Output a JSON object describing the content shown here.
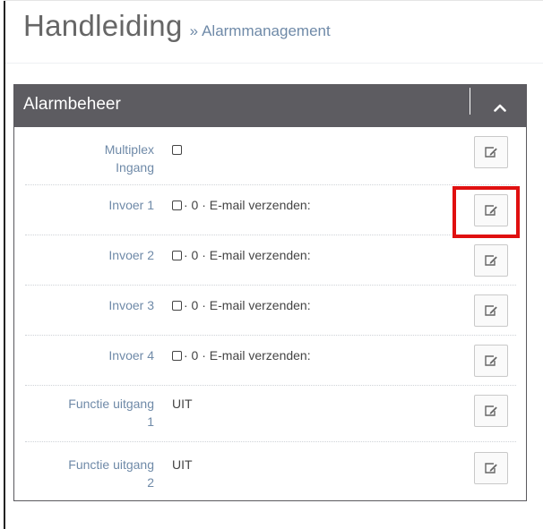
{
  "header": {
    "title": "Handleiding",
    "crumb_separator": "»",
    "crumb": "Alarmmanagement"
  },
  "panel": {
    "title": "Alarmbeheer",
    "collapse_icon": "chevron-up-icon",
    "rows": [
      {
        "label_line1": "Multiplex",
        "label_line2": "Ingang",
        "checkbox": true,
        "value": ""
      },
      {
        "label_line1": "Invoer 1",
        "label_line2": "",
        "checkbox": true,
        "value": "· 0 · E-mail verzenden:"
      },
      {
        "label_line1": "Invoer 2",
        "label_line2": "",
        "checkbox": true,
        "value": "· 0 · E-mail verzenden:"
      },
      {
        "label_line1": "Invoer 3",
        "label_line2": "",
        "checkbox": true,
        "value": "· 0 · E-mail verzenden:"
      },
      {
        "label_line1": "Invoer 4",
        "label_line2": "",
        "checkbox": true,
        "value": "· 0 · E-mail verzenden:"
      },
      {
        "label_line1": "Functie uitgang",
        "label_line2": "1",
        "checkbox": false,
        "value": "UIT"
      },
      {
        "label_line1": "Functie uitgang",
        "label_line2": "2",
        "checkbox": false,
        "value": "UIT"
      }
    ],
    "edit_icon": "edit-icon",
    "highlighted_row": "Invoer 1"
  },
  "colors": {
    "panel_header": "#5d5c61",
    "label": "#6f8aa8",
    "highlight": "#e01010"
  }
}
